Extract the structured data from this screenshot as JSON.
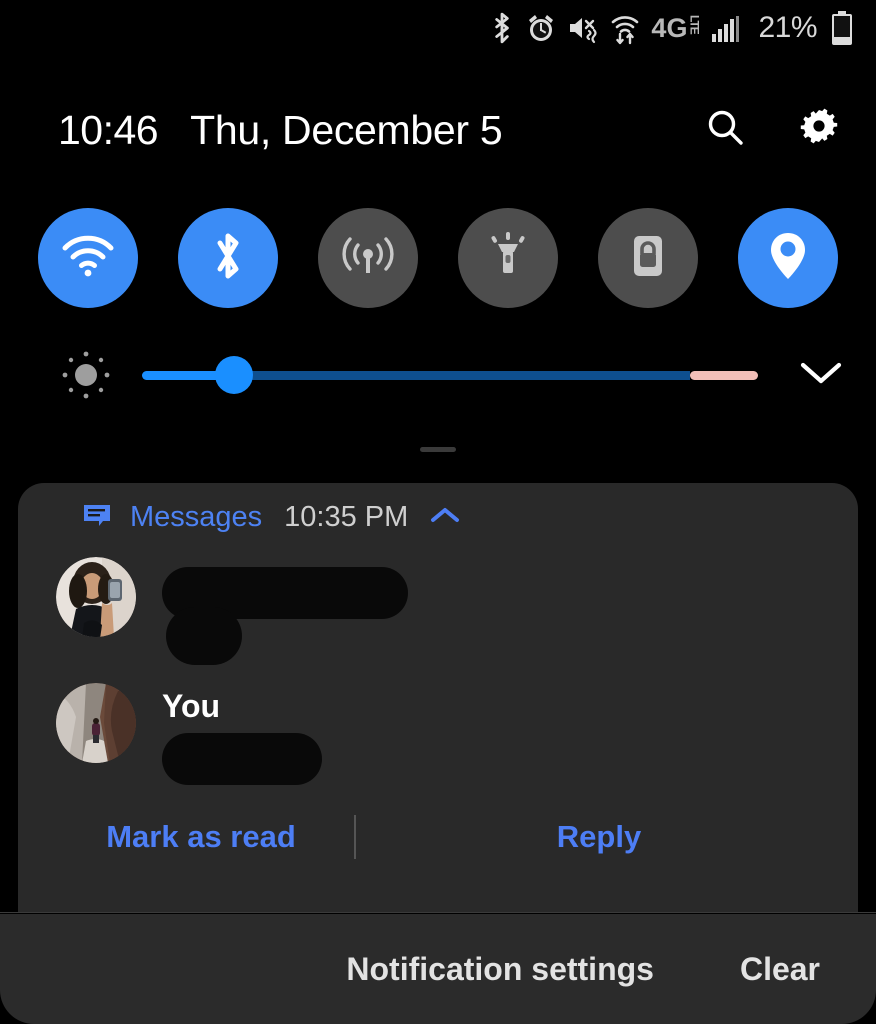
{
  "status_bar": {
    "icons": [
      {
        "name": "bluetooth-icon",
        "label": "Bluetooth"
      },
      {
        "name": "alarm-icon",
        "label": "Alarm set"
      },
      {
        "name": "vibrate-mute-icon",
        "label": "Sound off / vibrate"
      },
      {
        "name": "wifi-data-icon",
        "label": "Wi-Fi with data transfer"
      },
      {
        "name": "network-4glte-icon",
        "label": "4G LTE"
      },
      {
        "name": "signal-bars-icon",
        "label": "Cellular signal"
      }
    ],
    "network_label": "4G",
    "network_sublabel": "LTE",
    "battery_percent": "21%"
  },
  "header": {
    "time": "10:46",
    "date": "Thu, December 5",
    "search_label": "Search",
    "settings_label": "Settings"
  },
  "quick_settings": {
    "tiles": [
      {
        "name": "wifi-tile",
        "label": "Wi-Fi",
        "state": "on"
      },
      {
        "name": "bluetooth-tile",
        "label": "Bluetooth",
        "state": "on"
      },
      {
        "name": "mobile-data-tile",
        "label": "Mobile data",
        "state": "off"
      },
      {
        "name": "flashlight-tile",
        "label": "Flashlight",
        "state": "off"
      },
      {
        "name": "auto-rotate-tile",
        "label": "Auto rotate",
        "state": "off"
      },
      {
        "name": "location-tile",
        "label": "Location",
        "state": "on"
      }
    ],
    "brightness": {
      "label": "Brightness",
      "value_percent": 15,
      "blue_light_filter_percent": 11,
      "expand_label": "Expand quick settings"
    }
  },
  "notification": {
    "app_name": "Messages",
    "time": "10:35 PM",
    "collapse_label": "Collapse",
    "messages": [
      {
        "sender": "",
        "body": "",
        "redacted": true,
        "avatar": "contact-avatar"
      },
      {
        "sender": "You",
        "body": "",
        "redacted": true,
        "avatar": "your-avatar"
      }
    ],
    "actions": [
      {
        "name": "mark-as-read-button",
        "label": "Mark as read"
      },
      {
        "name": "reply-button",
        "label": "Reply"
      }
    ]
  },
  "bottom_bar": {
    "settings_label": "Notification settings",
    "clear_label": "Clear"
  },
  "colors": {
    "accent_blue": "#3b8cf6",
    "link_blue": "#4d7ef5",
    "tile_off": "#4d4d4d",
    "card_bg": "#292929",
    "screen_bg": "#000000",
    "blue_light_filter": "#f2bfb8"
  }
}
